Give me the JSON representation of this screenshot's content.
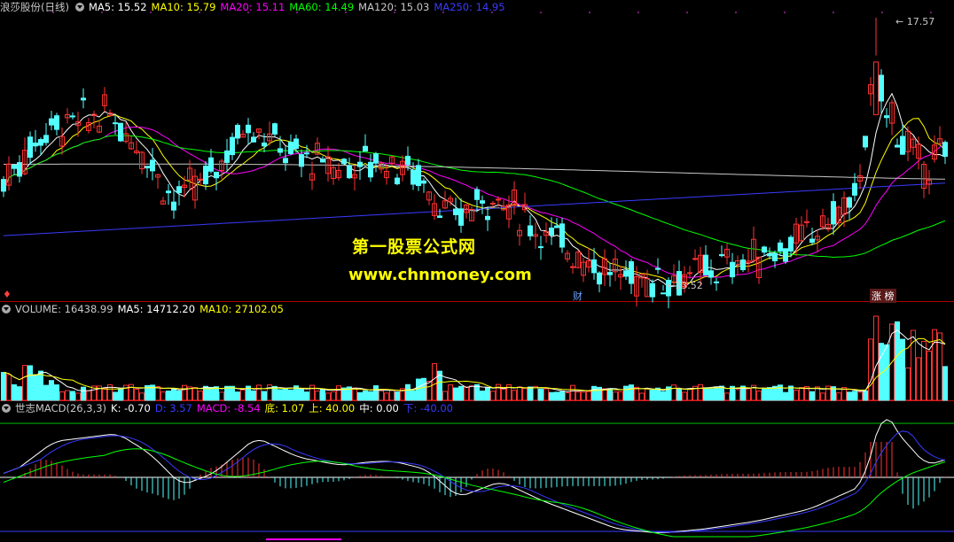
{
  "header": {
    "title": "浪莎股份(日线)",
    "ma": [
      {
        "label": "MA5: 15.52",
        "color": "#ffffff"
      },
      {
        "label": "MA10: 15.79",
        "color": "#ffff00"
      },
      {
        "label": "MA20: 15.11",
        "color": "#ff00ff"
      },
      {
        "label": "MA60: 14.49",
        "color": "#00ff00"
      },
      {
        "label": "MA120: 15.03",
        "color": "#c8c8c8"
      },
      {
        "label": "MA250: 14.95",
        "color": "#3a3aff"
      }
    ]
  },
  "volume_header": {
    "label": "VOLUME: 16438.99",
    "ma5": "MA5: 14712.20",
    "ma10": "MA10: 27102.05"
  },
  "macd_header": {
    "title": "世志MACD(26,3,3)",
    "items": [
      {
        "label": "K: -0.70",
        "color": "#ffffff"
      },
      {
        "label": "D: 3.57",
        "color": "#3a3aff"
      },
      {
        "label": "MACD: -8.54",
        "color": "#ff00ff"
      },
      {
        "label": "底: 1.07",
        "color": "#ffff00"
      },
      {
        "label": "上: 40.00",
        "color": "#ffff00"
      },
      {
        "label": "中: 0.00",
        "color": "#ffffff"
      },
      {
        "label": "下: -40.00",
        "color": "#3a3aff"
      }
    ]
  },
  "watermark": {
    "line1": "第一股票公式网",
    "line2": "www.chnmoney.com"
  },
  "annotations": {
    "high": "17.57",
    "low": "13.52",
    "cai": "财",
    "zhangbang": "涨 榜"
  },
  "colors": {
    "up": "#ff3232",
    "down": "#54ffff",
    "bg": "#000000",
    "divider": "#c00000"
  }
}
